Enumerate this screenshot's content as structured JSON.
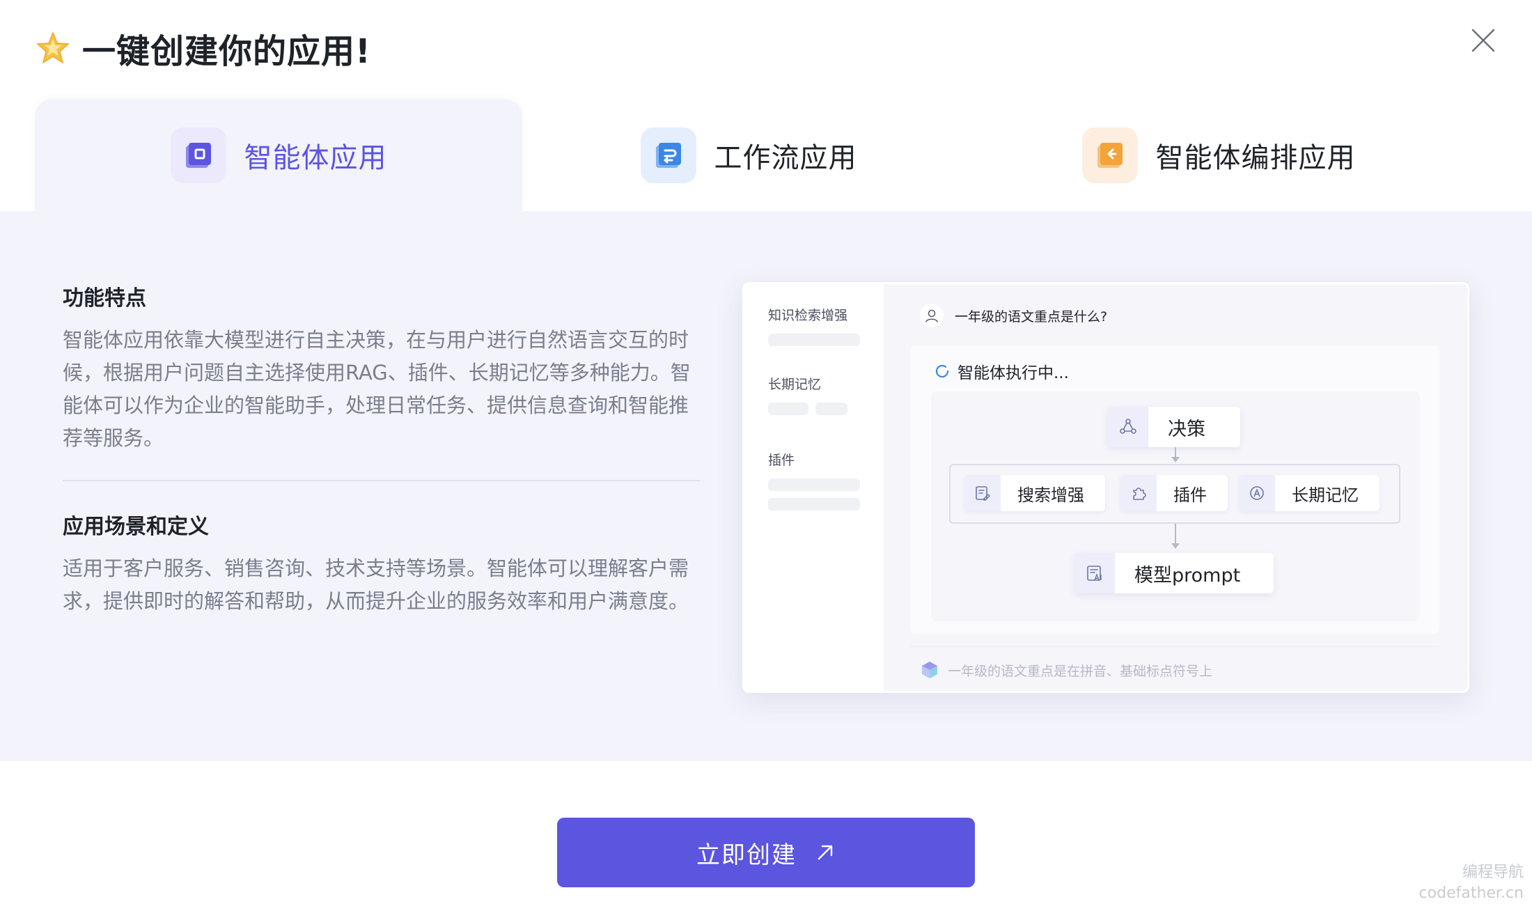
{
  "header": {
    "title": "一键创建你的应用!"
  },
  "tabs": [
    {
      "label": "智能体应用",
      "icon": "agent-app-icon",
      "active": true
    },
    {
      "label": "工作流应用",
      "icon": "workflow-app-icon",
      "active": false
    },
    {
      "label": "智能体编排应用",
      "icon": "agent-orchestration-icon",
      "active": false
    }
  ],
  "features": {
    "title": "功能特点",
    "body": "智能体应用依靠大模型进行自主决策，在与用户进行自然语言交互的时候，根据用户问题自主选择使用RAG、插件、长期记忆等多种能力。智能体可以作为企业的智能助手，处理日常任务、提供信息查询和智能推荐等服务。"
  },
  "scenarios": {
    "title": "应用场景和定义",
    "body": "适用于客户服务、销售咨询、技术支持等场景。智能体可以理解客户需求，提供即时的解答和帮助，从而提升企业的服务效率和用户满意度。"
  },
  "preview": {
    "sidebar": [
      "知识检索增强",
      "长期记忆",
      "插件"
    ],
    "question": "一年级的语文重点是什么?",
    "status": "智能体执行中...",
    "nodes": {
      "decision": "决策",
      "search": "搜索增强",
      "plugin": "插件",
      "memory": "长期记忆",
      "model": "模型prompt"
    },
    "answer": "一年级的语文重点是在拼音、基础标点符号上"
  },
  "actions": {
    "create_label": "立即创建"
  },
  "watermark": {
    "line1": "编程导航",
    "line2": "codefather.cn"
  },
  "colors": {
    "accent": "#5b55e0",
    "panel_bg": "#f3f3fb",
    "text_muted": "#7a7f8c"
  }
}
